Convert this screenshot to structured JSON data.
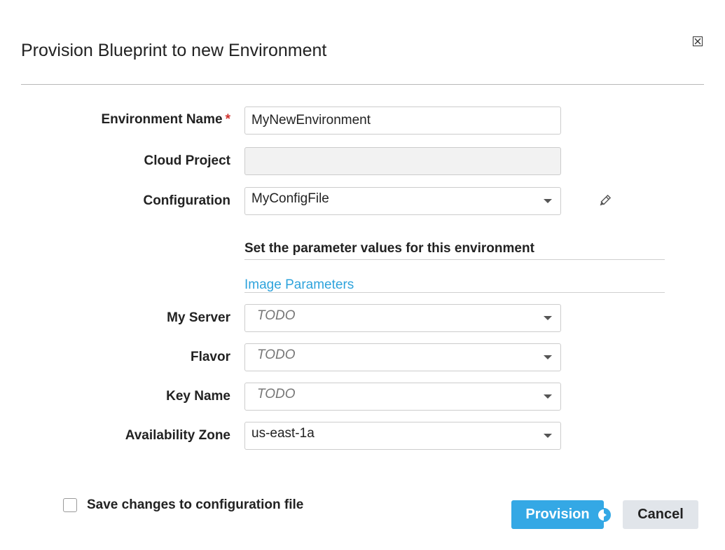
{
  "dialog": {
    "title": "Provision Blueprint to new Environment"
  },
  "form": {
    "environment_name": {
      "label": "Environment Name",
      "required_mark": "*",
      "value": "MyNewEnvironment"
    },
    "cloud_project": {
      "label": "Cloud Project",
      "value": ""
    },
    "configuration": {
      "label": "Configuration",
      "value": "MyConfigFile"
    }
  },
  "parameters": {
    "heading": "Set the parameter values for this environment",
    "section_link": "Image Parameters",
    "fields": [
      {
        "label": "My Server",
        "value": "TODO"
      },
      {
        "label": "Flavor",
        "value": "TODO"
      },
      {
        "label": "Key Name",
        "value": "TODO"
      },
      {
        "label": "Availability Zone",
        "value": "us-east-1a"
      }
    ]
  },
  "footer": {
    "save_checkbox_label": "Save changes to configuration file",
    "save_checked": false,
    "provision_label": "Provision",
    "cancel_label": "Cancel"
  },
  "colors": {
    "primary": "#34a8e5",
    "link": "#2ea3dc",
    "required": "#d0312d",
    "secondary_button": "#e1e5ea"
  },
  "icons": {
    "close": "close-icon",
    "edit": "pencil-icon",
    "dropdown": "chevron-down-icon",
    "busy": "spinner-icon"
  }
}
